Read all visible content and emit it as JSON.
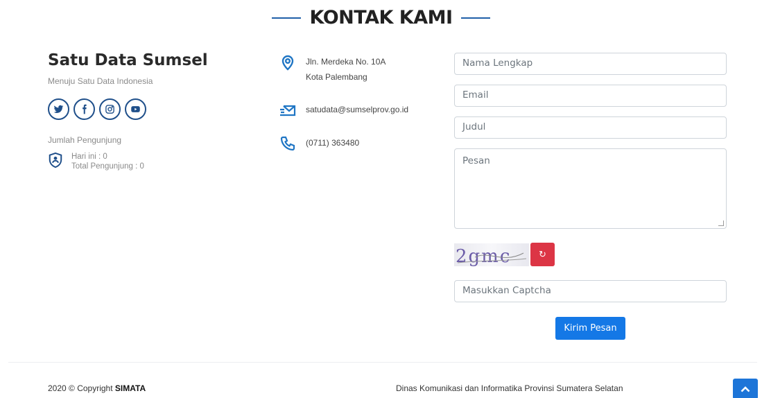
{
  "header": {
    "title": "KONTAK KAMI"
  },
  "brand": {
    "name": "Satu Data Sumsel",
    "tagline": "Menuju Satu Data Indonesia"
  },
  "socials": [
    {
      "icon": "twitter-icon"
    },
    {
      "icon": "facebook-icon"
    },
    {
      "icon": "instagram-icon"
    },
    {
      "icon": "youtube-icon"
    }
  ],
  "visitors": {
    "label": "Jumlah Pengunjung",
    "today": "Hari ini : 0",
    "total": "Total Pengunjung : 0"
  },
  "contact": {
    "address_line1": "Jln. Merdeka No. 10A",
    "address_line2": "Kota Palembang",
    "email": "satudata@sumselprov.go.id",
    "phone": "(0711) 363480"
  },
  "form": {
    "name_placeholder": "Nama Lengkap",
    "email_placeholder": "Email",
    "subject_placeholder": "Judul",
    "message_placeholder": "Pesan",
    "captcha_placeholder": "Masukkan Captcha",
    "captcha_text": "2gmc",
    "submit_label": "Kirim Pesan"
  },
  "footer": {
    "copyright_prefix": "2020 © Copyright ",
    "copyright_brand": "SIMATA",
    "org": "Dinas Komunikasi dan Informatika Provinsi Sumatera Selatan"
  },
  "colors": {
    "accent": "#1478e6",
    "icon": "#1f4f8a",
    "danger": "#dc3545"
  }
}
